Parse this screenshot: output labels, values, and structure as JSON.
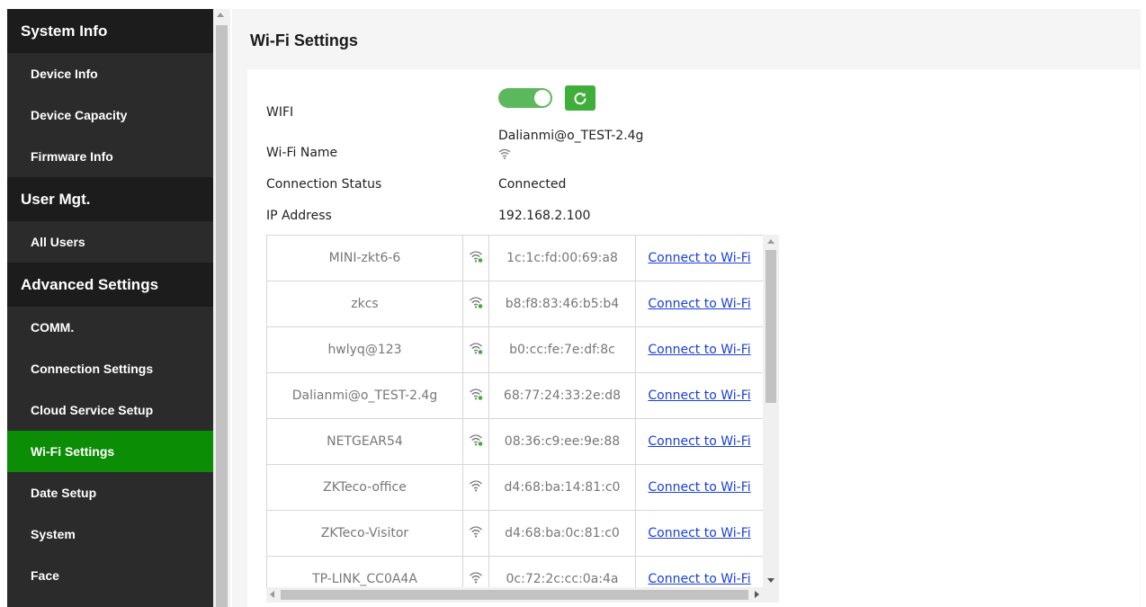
{
  "sidebar": {
    "sections": [
      {
        "title": "System Info",
        "items": [
          "Device Info",
          "Device Capacity",
          "Firmware Info"
        ]
      },
      {
        "title": "User Mgt.",
        "items": [
          "All Users"
        ]
      },
      {
        "title": "Advanced Settings",
        "items": [
          "COMM.",
          "Connection Settings",
          "Cloud Service Setup",
          "Wi-Fi Settings",
          "Date Setup",
          "System",
          "Face"
        ]
      }
    ],
    "active_item": "Wi-Fi Settings"
  },
  "page": {
    "title": "Wi-Fi Settings",
    "wifi_label": "WIFI",
    "wifi_enabled": true,
    "name_label": "Wi-Fi Name",
    "name_value": "Dalianmi@o_TEST-2.4g",
    "status_label": "Connection Status",
    "status_value": "Connected",
    "ip_label": "IP Address",
    "ip_value": "192.168.2.100"
  },
  "networks": [
    {
      "ssid": "MINI-zkt6-6",
      "mac": "1c:1c:fd:00:69:a8",
      "secured": false,
      "action": "Connect to Wi-Fi"
    },
    {
      "ssid": "zkcs",
      "mac": "b8:f8:83:46:b5:b4",
      "secured": false,
      "action": "Connect to Wi-Fi"
    },
    {
      "ssid": "hwlyq@123",
      "mac": "b0:cc:fe:7e:df:8c",
      "secured": false,
      "action": "Connect to Wi-Fi"
    },
    {
      "ssid": "Dalianmi@o_TEST-2.4g",
      "mac": "68:77:24:33:2e:d8",
      "secured": false,
      "action": "Connect to Wi-Fi"
    },
    {
      "ssid": "NETGEAR54",
      "mac": "08:36:c9:ee:9e:88",
      "secured": false,
      "action": "Connect to Wi-Fi"
    },
    {
      "ssid": "ZKTeco-office",
      "mac": "d4:68:ba:14:81:c0",
      "secured": true,
      "action": "Connect to Wi-Fi"
    },
    {
      "ssid": "ZKTeco-Visitor",
      "mac": "d4:68:ba:0c:81:c0",
      "secured": true,
      "action": "Connect to Wi-Fi"
    },
    {
      "ssid": "TP-LINK_CC0A4A",
      "mac": "0c:72:2c:cc:0a:4a",
      "secured": true,
      "action": "Connect to Wi-Fi"
    }
  ],
  "colors": {
    "sidebar_bg": "#2b2b2b",
    "section_bg": "#1c1c1c",
    "active_bg": "#0b8d05",
    "toggle_on": "#5cb85c",
    "link": "#1a3fd9"
  },
  "icons": {
    "wifi_open": "wifi-open-icon",
    "wifi_secured": "wifi-icon",
    "refresh": "refresh-icon"
  }
}
